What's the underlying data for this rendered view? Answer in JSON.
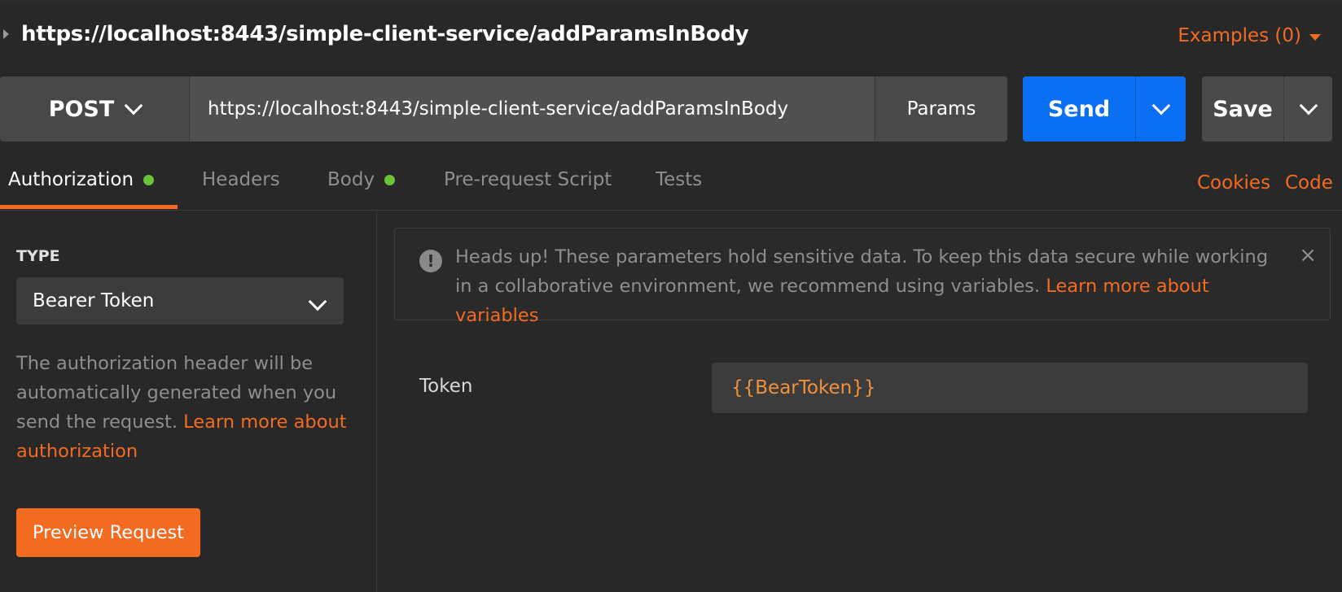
{
  "request": {
    "title": "https://localhost:8443/simple-client-service/addParamsInBody",
    "examples_label": "Examples (0)"
  },
  "urlbar": {
    "method": "POST",
    "url": "https://localhost:8443/simple-client-service/addParamsInBody",
    "params_label": "Params",
    "send_label": "Send",
    "save_label": "Save"
  },
  "tabs": [
    {
      "label": "Authorization",
      "active": true,
      "indicator": true
    },
    {
      "label": "Headers",
      "active": false,
      "indicator": false
    },
    {
      "label": "Body",
      "active": false,
      "indicator": true
    },
    {
      "label": "Pre-request Script",
      "active": false,
      "indicator": false
    },
    {
      "label": "Tests",
      "active": false,
      "indicator": false
    }
  ],
  "tab_links": {
    "cookies": "Cookies",
    "code": "Code"
  },
  "auth": {
    "type_label": "TYPE",
    "type_value": "Bearer Token",
    "description": "The authorization header will be automatically generated when you send the request. ",
    "description_link": "Learn more about authorization",
    "preview_button": "Preview Request"
  },
  "alert": {
    "text": "Heads up! These parameters hold sensitive data. To keep this data secure while working in a collaborative environment, we recommend using variables. ",
    "link": "Learn more about variables",
    "icon": "!",
    "close": "×"
  },
  "token": {
    "label": "Token",
    "value": "{{BearToken}}"
  },
  "colors": {
    "accent": "#f26b21",
    "send": "#0a6ff2",
    "indicator": "#6bc437",
    "background": "#282828"
  }
}
